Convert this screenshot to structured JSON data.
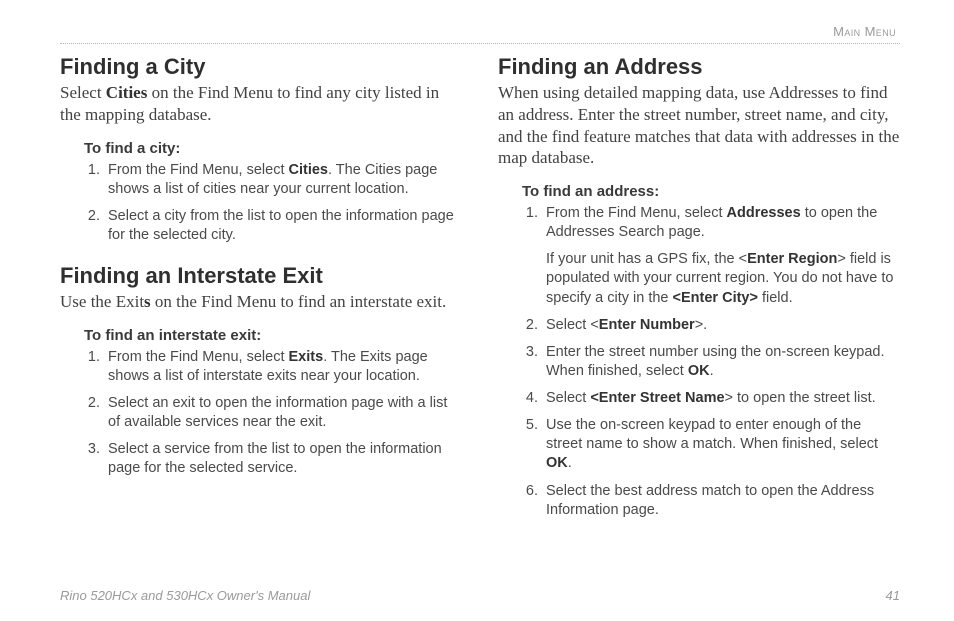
{
  "header": {
    "section_label": "Main Menu"
  },
  "left": {
    "city": {
      "title": "Finding a City",
      "lead_pre": "Select ",
      "lead_bold": "Cities",
      "lead_post": " on the Find Menu to find any city listed in the mapping database.",
      "subhead": "To find a city:",
      "steps": {
        "s1_pre": "From the Find Menu, select ",
        "s1_bold": "Cities",
        "s1_post": ". The Cities page shows a list of cities near your current location.",
        "s2": "Select a city from the list to open the information page for the selected city."
      }
    },
    "exit": {
      "title": "Finding an Interstate Exit",
      "lead_pre": "Use the Exit",
      "lead_bold": "s",
      "lead_post": " on the Find Menu to find an interstate exit.",
      "subhead": "To find an interstate exit:",
      "steps": {
        "s1_pre": "From the Find Menu, select ",
        "s1_bold": "Exits",
        "s1_post": ". The Exits page shows a list of interstate exits near your location.",
        "s2": "Select an exit to open the information page with a list of available services near the exit.",
        "s3": "Select a service from the list to open the information page for the selected service."
      }
    }
  },
  "right": {
    "addr": {
      "title": "Finding an Address",
      "lead": "When using detailed mapping data, use Addresses to find an address. Enter the street number, street name, and city, and the find feature matches that data with addresses in the map database.",
      "subhead": "To find an address:",
      "steps": {
        "s1_pre": "From the Find Menu, select ",
        "s1_bold": "Addresses",
        "s1_post": " to open the Addresses Search page.",
        "s1_note_pre": "If your unit has a GPS fix, the <",
        "s1_note_b1": "Enter Region",
        "s1_note_mid": "> field is populated with your current region. You do not have to specify a city in the ",
        "s1_note_b2": "<Enter City>",
        "s1_note_post": " field.",
        "s2_pre": "Select <",
        "s2_bold": "Enter Number",
        "s2_post": ">.",
        "s3_pre": "Enter the street number using the on-screen keypad. When finished, select ",
        "s3_bold": "OK",
        "s3_post": ".",
        "s4_pre": "Select ",
        "s4_bold": "<Enter Street Name",
        "s4_post": "> to open the street list.",
        "s5_pre": "Use the on-screen keypad to enter enough of the street name to show a match. When finished, select ",
        "s5_bold": "OK",
        "s5_post": ".",
        "s6": "Select the best address match to open the Address Information page."
      }
    }
  },
  "footer": {
    "manual": "Rino 520HCx and 530HCx Owner's Manual",
    "page": "41"
  }
}
